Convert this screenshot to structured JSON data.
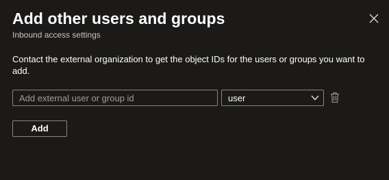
{
  "panel": {
    "title": "Add other users and groups",
    "subtitle": "Inbound access settings",
    "close_icon": "close-icon"
  },
  "instructions": "Contact the external organization to get the object IDs for the users or groups you want to add.",
  "form": {
    "id_input": {
      "value": "",
      "placeholder": "Add external user or group id"
    },
    "type_select": {
      "selected": "user",
      "icon": "chevron-down-icon"
    },
    "delete_icon": "trash-icon"
  },
  "actions": {
    "add_label": "Add"
  },
  "colors": {
    "background": "#1b1a19",
    "border": "#8a8886",
    "text": "#ffffff",
    "muted_text": "#c8c6c4",
    "placeholder": "#a19f9d"
  }
}
